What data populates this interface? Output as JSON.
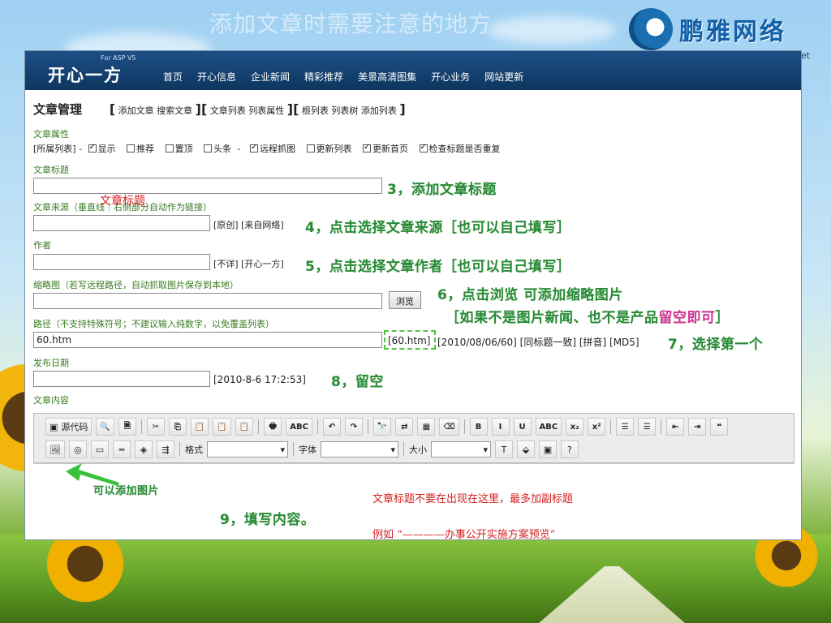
{
  "slide": {
    "title": "添加文章时需要注意的地方",
    "logo_text": "鹏雅网络",
    "logo_sub": "et",
    "colors": {
      "annotation_green": "#2a8a38",
      "note_red": "#d61f1f",
      "nav_blue": "#0e365f"
    }
  },
  "app": {
    "brand_sub": "For ASP V5",
    "brand": "开心一方",
    "nav": [
      "首页",
      "开心信息",
      "企业新闻",
      "精彩推荐",
      "美景高清图集",
      "开心业务",
      "网站更新"
    ]
  },
  "page": {
    "title": "文章管理",
    "crumb_groups": [
      [
        "添加文章",
        "搜索文章"
      ],
      [
        "文章列表",
        "列表属性"
      ],
      [
        "根列表",
        "列表树",
        "添加列表"
      ]
    ]
  },
  "form": {
    "attr_label": "文章属性",
    "attr_prefix": "[所属列表] -",
    "attr_dash": "-",
    "attrs1": [
      {
        "label": "显示",
        "checked": true
      },
      {
        "label": "推荐",
        "checked": false
      },
      {
        "label": "置顶",
        "checked": false
      },
      {
        "label": "头条",
        "checked": false
      }
    ],
    "attrs2": [
      {
        "label": "远程抓图",
        "checked": true
      },
      {
        "label": "更新列表",
        "checked": false
      },
      {
        "label": "更新首页",
        "checked": true
      },
      {
        "label": "检查标题是否重复",
        "checked": true
      }
    ],
    "title_label": "文章标题",
    "title_value": "",
    "source_label": "文章来源（垂直线｜右侧部分自动作为链接）",
    "source_value": "",
    "source_options": "[原创] [来自网络]",
    "author_label": "作者",
    "author_value": "",
    "author_options": "[不详] [开心一方]",
    "thumb_label": "缩略图（若写远程路径，自动抓取图片保存到本地）",
    "thumb_value": "",
    "browse_button": "浏览",
    "path_label": "路径（不支持特殊符号；不建议输入纯数字，以免覆盖列表）",
    "path_value": "60.htm",
    "path_first_option": "[60.htm]",
    "path_options": "[2010/08/06/60] [同标题一致] [拼音] [MD5]",
    "date_label": "发布日期",
    "date_value": "",
    "date_hint": "[2010-8-6 17:2:53]",
    "content_label": "文章内容"
  },
  "overlay": {
    "title_ghost": "文章标题"
  },
  "annotations": {
    "a3": "3，添加文章标题",
    "a4": "4，点击选择文章来源［也可以自己填写］",
    "a5": "5，点击选择文章作者［也可以自己填写］",
    "a6": "6，点击浏览 可添加缩略图片",
    "a6b_prefix": "［如果不是图片新闻、也不是产品",
    "a6b_highlight": "留空即可",
    "a6b_suffix": "］",
    "a7": "7，选择第一个",
    "a8": "8，留空",
    "a9": "9，填写内容。",
    "image_hint": "可以添加图片"
  },
  "notes": {
    "line1": "文章标题不要在出现在这里，最多加副标题",
    "line2": "例如 “————办事公开实施方案预览”"
  },
  "toolbar": {
    "source_button": "源代码",
    "style_label": "格式",
    "font_label": "字体",
    "size_label": "大小",
    "row1_icons": [
      "preview-icon",
      "template-icon",
      "cut-icon",
      "copy-icon",
      "paste-icon",
      "paste-text-icon",
      "paste-word-icon",
      "print-icon",
      "spellcheck-icon",
      "undo-icon",
      "redo-icon",
      "find-icon",
      "replace-icon",
      "select-all-icon",
      "remove-format-icon",
      "bold-icon",
      "italic-icon",
      "underline-icon",
      "strike-icon",
      "subscript-icon",
      "superscript-icon",
      "ordered-list-icon",
      "unordered-list-icon",
      "outdent-icon",
      "indent-icon",
      "blockquote-icon"
    ],
    "row1_glyphs": [
      "🔍",
      "🗎",
      "✂",
      "⎘",
      "📋",
      "📋",
      "📋",
      "🖶",
      "ABC",
      "↶",
      "↷",
      "🔭",
      "⇄",
      "▦",
      "⌫",
      "B",
      "I",
      "U",
      "ABC",
      "x₂",
      "x²",
      "☰",
      "☰",
      "⇤",
      "⇥",
      "❝"
    ],
    "row2_icons": [
      "image-icon",
      "flash-icon",
      "table-icon",
      "hr-icon",
      "smiley-icon",
      "pagebreak-icon"
    ],
    "row2_glyphs": [
      "🖼",
      "◎",
      "▭",
      "═",
      "◈",
      "⇶"
    ],
    "row2_tail_icons": [
      "text-color-icon",
      "bg-color-icon",
      "maximize-icon",
      "help-icon"
    ],
    "row2_tail_glyphs": [
      "T",
      "⬙",
      "▣",
      "?"
    ]
  }
}
